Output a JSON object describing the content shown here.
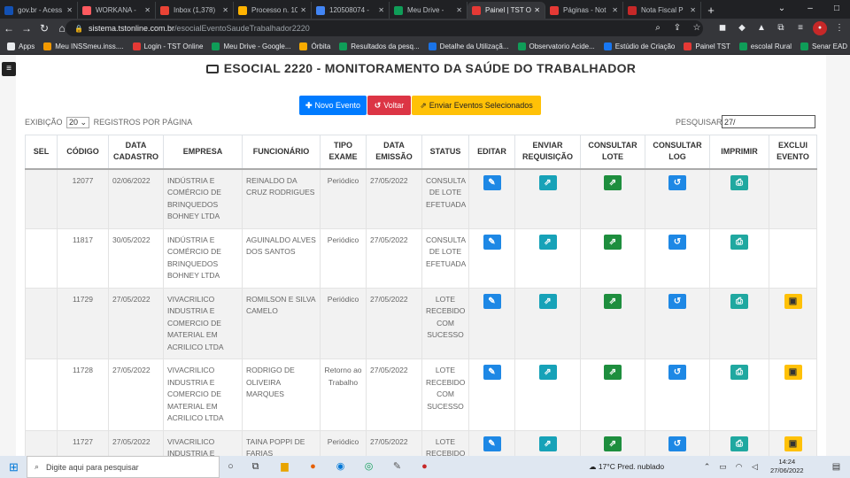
{
  "browser": {
    "tabs": [
      {
        "label": "gov.br - Acess",
        "color": "#1351b4"
      },
      {
        "label": "WORKANA - ",
        "color": "#ff5a5f"
      },
      {
        "label": "Inbox (1,378)",
        "color": "#ea4335"
      },
      {
        "label": "Processo n. 10",
        "color": "#ffb300"
      },
      {
        "label": "120508074 - ",
        "color": "#4285f4"
      },
      {
        "label": "Meu Drive - ",
        "color": "#0f9d58"
      },
      {
        "label": "Painel | TST O",
        "color": "#e53935",
        "active": true
      },
      {
        "label": "Páginas - Not",
        "color": "#e53935"
      },
      {
        "label": "Nota Fiscal P",
        "color": "#c62828"
      }
    ],
    "url_host": "sistema.tstonline.com.br",
    "url_path": "/esocialEventoSaudeTrabalhador2220",
    "bookmarks": [
      {
        "label": "Apps",
        "color": "#e8eaed"
      },
      {
        "label": "Meu INSSmeu.inss....",
        "color": "#f29900"
      },
      {
        "label": "Login - TST Online",
        "color": "#e53935"
      },
      {
        "label": "Meu Drive - Google...",
        "color": "#0f9d58"
      },
      {
        "label": "Órbita",
        "color": "#f9ab00"
      },
      {
        "label": "Resultados da pesq...",
        "color": "#0f9d58"
      },
      {
        "label": "Detalhe da Utilizaçã...",
        "color": "#1a73e8"
      },
      {
        "label": "Observatorio Acide...",
        "color": "#0f9d58"
      },
      {
        "label": "Estúdio de Criação",
        "color": "#1877f2"
      },
      {
        "label": "Painel TST",
        "color": "#e53935"
      },
      {
        "label": "escolal Rural",
        "color": "#0f9d58"
      },
      {
        "label": "Senar EAD",
        "color": "#0f9d58"
      }
    ]
  },
  "page": {
    "title": "ESOCIAL 2220 - MONITORAMENTO DA SAÚDE DO TRABALHADOR",
    "buttons": {
      "new": "Novo Evento",
      "back": "Voltar",
      "send": "Enviar Eventos Selecionados"
    },
    "exibicao_label": "EXIBIÇÃO",
    "page_size": "20",
    "registros_label": "REGISTROS POR PÁGINA",
    "search_label": "PESQUISAR:",
    "search_value": "27/"
  },
  "table": {
    "headers": [
      "SEL",
      "CÓDIGO",
      "DATA\nCADASTRO",
      "EMPRESA",
      "FUNCIONÁRIO",
      "TIPO\nEXAME",
      "DATA\nEMISSÃO",
      "STATUS",
      "EDITAR",
      "ENVIAR\nREQUISIÇÃO",
      "CONSULTAR\nLOTE",
      "CONSULTAR\nLOG",
      "IMPRIMIR",
      "EXCLUI\nEVENTO"
    ],
    "rows": [
      {
        "codigo": "12077",
        "data_cadastro": "02/06/2022",
        "empresa": "INDÚSTRIA E COMÉRCIO DE BRINQUEDOS BOHNEY LTDA",
        "funcionario": "REINALDO DA CRUZ RODRIGUES",
        "tipo": "Periódico",
        "data_emissao": "27/05/2022",
        "status": "CONSULTA DE LOTE EFETUADA",
        "excluir": false
      },
      {
        "codigo": "11817",
        "data_cadastro": "30/05/2022",
        "empresa": "INDÚSTRIA E COMÉRCIO DE BRINQUEDOS BOHNEY LTDA",
        "funcionario": "AGUINALDO ALVES DOS SANTOS",
        "tipo": "Periódico",
        "data_emissao": "27/05/2022",
        "status": "CONSULTA DE LOTE EFETUADA",
        "excluir": false
      },
      {
        "codigo": "11729",
        "data_cadastro": "27/05/2022",
        "empresa": "VIVACRILICO INDUSTRIA E COMERCIO DE MATERIAL EM ACRILICO LTDA",
        "funcionario": "ROMILSON E SILVA CAMELO",
        "tipo": "Periódico",
        "data_emissao": "27/05/2022",
        "status": "LOTE RECEBIDO COM SUCESSO",
        "excluir": true
      },
      {
        "codigo": "11728",
        "data_cadastro": "27/05/2022",
        "empresa": "VIVACRILICO INDUSTRIA E COMERCIO DE MATERIAL EM ACRILICO LTDA",
        "funcionario": "RODRIGO DE OLIVEIRA MARQUES",
        "tipo": "Retorno ao Trabalho",
        "data_emissao": "27/05/2022",
        "status": "LOTE RECEBIDO COM SUCESSO",
        "excluir": true
      },
      {
        "codigo": "11727",
        "data_cadastro": "27/05/2022",
        "empresa": "VIVACRILICO INDUSTRIA E COMERCIO DE",
        "funcionario": "TAINA POPPI DE FARIAS",
        "tipo": "Periódico",
        "data_emissao": "27/05/2022",
        "status": "LOTE RECEBIDO COM",
        "excluir": true
      }
    ]
  },
  "taskbar": {
    "search_placeholder": "Digite aqui para pesquisar",
    "weather": "17°C  Pred. nublado",
    "time": "14:24",
    "date": "27/06/2022"
  }
}
